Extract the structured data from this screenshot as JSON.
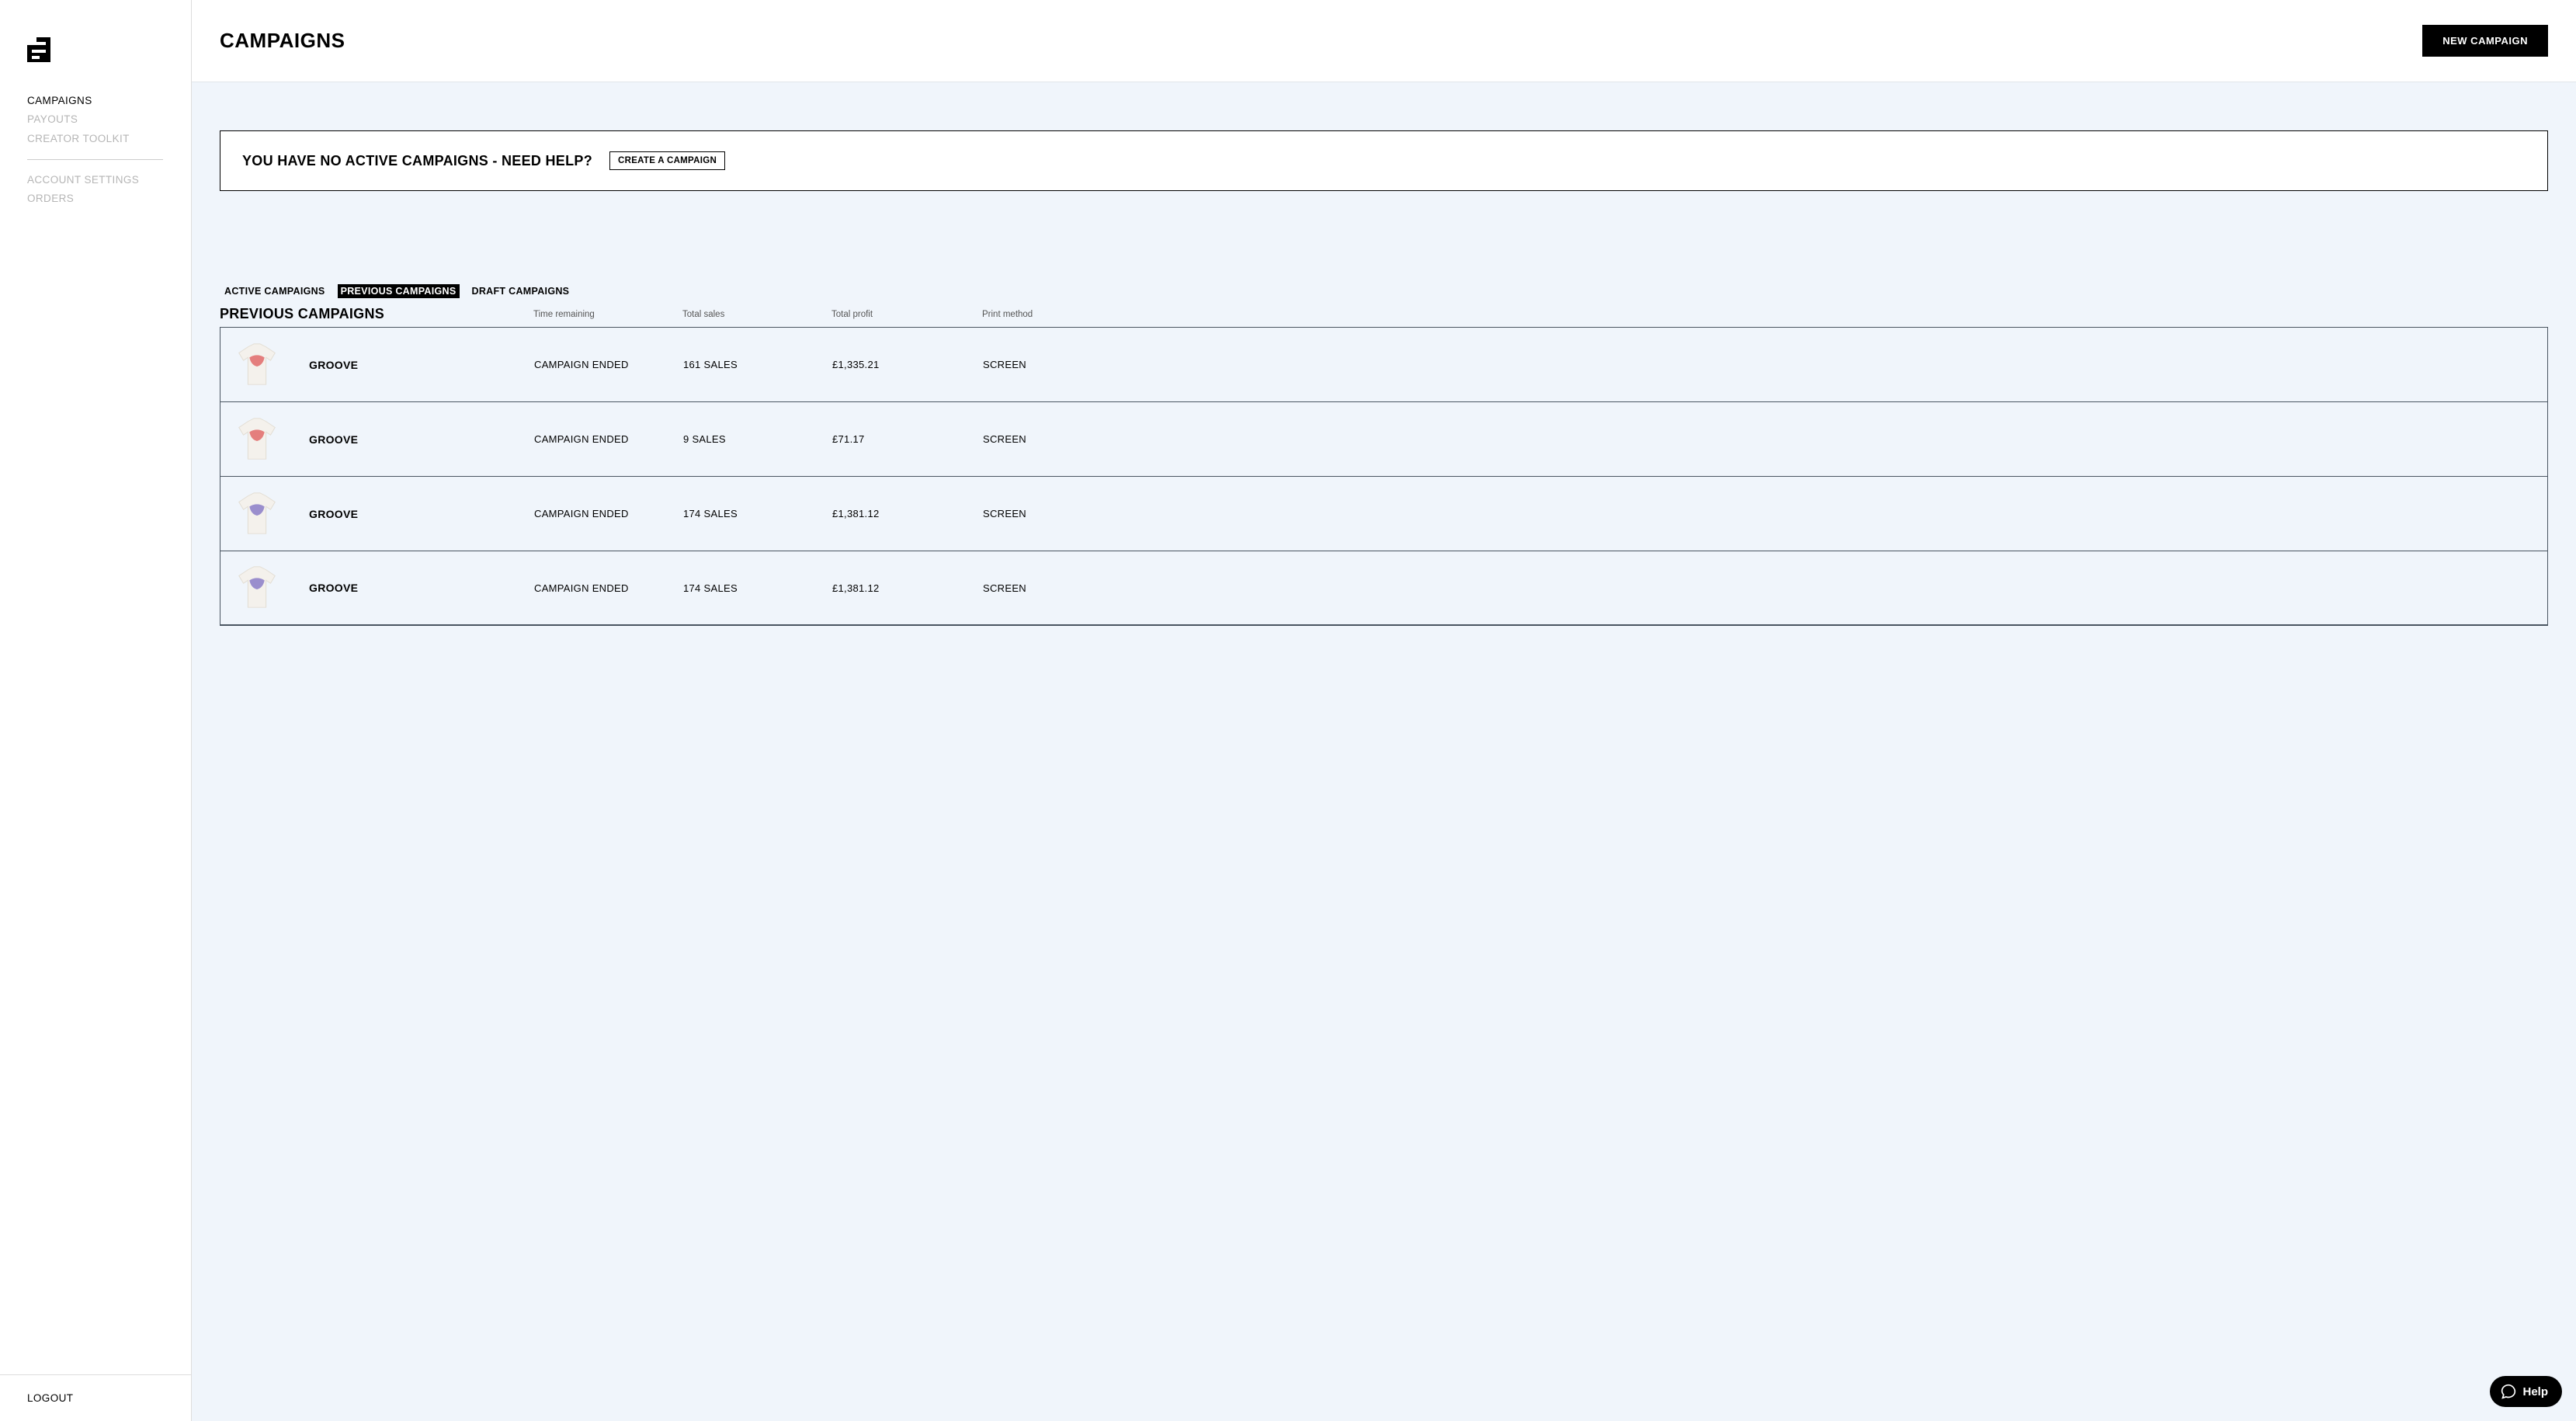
{
  "sidebar": {
    "nav1": [
      {
        "label": "CAMPAIGNS",
        "active": true
      },
      {
        "label": "PAYOUTS",
        "active": false
      },
      {
        "label": "CREATOR TOOLKIT",
        "active": false
      }
    ],
    "nav2": [
      {
        "label": "ACCOUNT SETTINGS"
      },
      {
        "label": "ORDERS"
      }
    ],
    "logout": "LOGOUT"
  },
  "header": {
    "title": "CAMPAIGNS",
    "new_button": "NEW CAMPAIGN"
  },
  "notice": {
    "text": "YOU HAVE NO ACTIVE CAMPAIGNS - NEED HELP?",
    "cta": "CREATE A CAMPAIGN"
  },
  "tabs": [
    {
      "label": "ACTIVE CAMPAIGNS",
      "active": false
    },
    {
      "label": "PREVIOUS CAMPAIGNS",
      "active": true
    },
    {
      "label": "DRAFT CAMPAIGNS",
      "active": false
    }
  ],
  "table": {
    "section_label": "PREVIOUS CAMPAIGNS",
    "headers": {
      "time": "Time remaining",
      "sales": "Total sales",
      "profit": "Total profit",
      "print": "Print method"
    },
    "rows": [
      {
        "name": "GROOVE",
        "time": "CAMPAIGN ENDED",
        "sales": "161 SALES",
        "profit": "£1,335.21",
        "print": "SCREEN",
        "variant": "red"
      },
      {
        "name": "GROOVE",
        "time": "CAMPAIGN ENDED",
        "sales": "9 SALES",
        "profit": "£71.17",
        "print": "SCREEN",
        "variant": "red"
      },
      {
        "name": "GROOVE",
        "time": "CAMPAIGN ENDED",
        "sales": "174 SALES",
        "profit": "£1,381.12",
        "print": "SCREEN",
        "variant": "purple"
      },
      {
        "name": "GROOVE",
        "time": "CAMPAIGN ENDED",
        "sales": "174 SALES",
        "profit": "£1,381.12",
        "print": "SCREEN",
        "variant": "purple"
      }
    ]
  },
  "help": {
    "label": "Help"
  },
  "colors": {
    "red": "#e06a6a",
    "purple": "#8a7cc8"
  }
}
